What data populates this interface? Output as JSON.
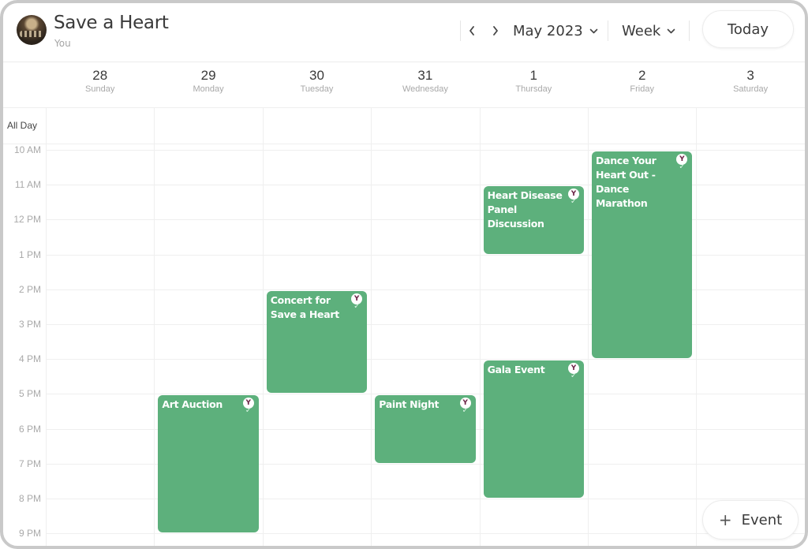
{
  "header": {
    "title": "Save a Heart",
    "subtitle": "You",
    "month_label": "May 2023",
    "view_label": "Week",
    "today_label": "Today",
    "prev_icon": "chevron-left-icon",
    "next_icon": "chevron-right-icon"
  },
  "days": [
    {
      "num": "28",
      "name": "Sunday"
    },
    {
      "num": "29",
      "name": "Monday"
    },
    {
      "num": "30",
      "name": "Tuesday"
    },
    {
      "num": "31",
      "name": "Wednesday"
    },
    {
      "num": "1",
      "name": "Thursday"
    },
    {
      "num": "2",
      "name": "Friday"
    },
    {
      "num": "3",
      "name": "Saturday"
    }
  ],
  "all_day_label": "All Day",
  "hours": [
    "10 AM",
    "11 AM",
    "12 PM",
    "1 PM",
    "2 PM",
    "3 PM",
    "4 PM",
    "5 PM",
    "6 PM",
    "7 PM",
    "8 PM",
    "9 PM"
  ],
  "event_color": "#5db07c",
  "events": [
    {
      "title": "Art Auction",
      "day": 1,
      "start": "5 PM",
      "end": "9 PM",
      "badge": "Y",
      "status": "accepted"
    },
    {
      "title": "Concert for Save a Heart",
      "day": 2,
      "start": "2 PM",
      "end": "5 PM",
      "badge": "Y",
      "status": "accepted"
    },
    {
      "title": "Paint Night",
      "day": 3,
      "start": "5 PM",
      "end": "7 PM",
      "badge": "Y",
      "status": "accepted"
    },
    {
      "title": "Heart Disease Panel Discussion",
      "day": 4,
      "start": "11 AM",
      "end": "1 PM",
      "badge": "Y",
      "status": "accepted"
    },
    {
      "title": "Gala Event",
      "day": 4,
      "start": "4 PM",
      "end": "8 PM",
      "badge": "Y",
      "status": "accepted"
    },
    {
      "title": "Dance Your Heart Out - Dance Marathon",
      "day": 5,
      "start": "10 AM",
      "end": "4 PM",
      "badge": "Y",
      "status": "accepted"
    }
  ],
  "add_event": {
    "icon": "plus-icon",
    "label": "Event"
  }
}
